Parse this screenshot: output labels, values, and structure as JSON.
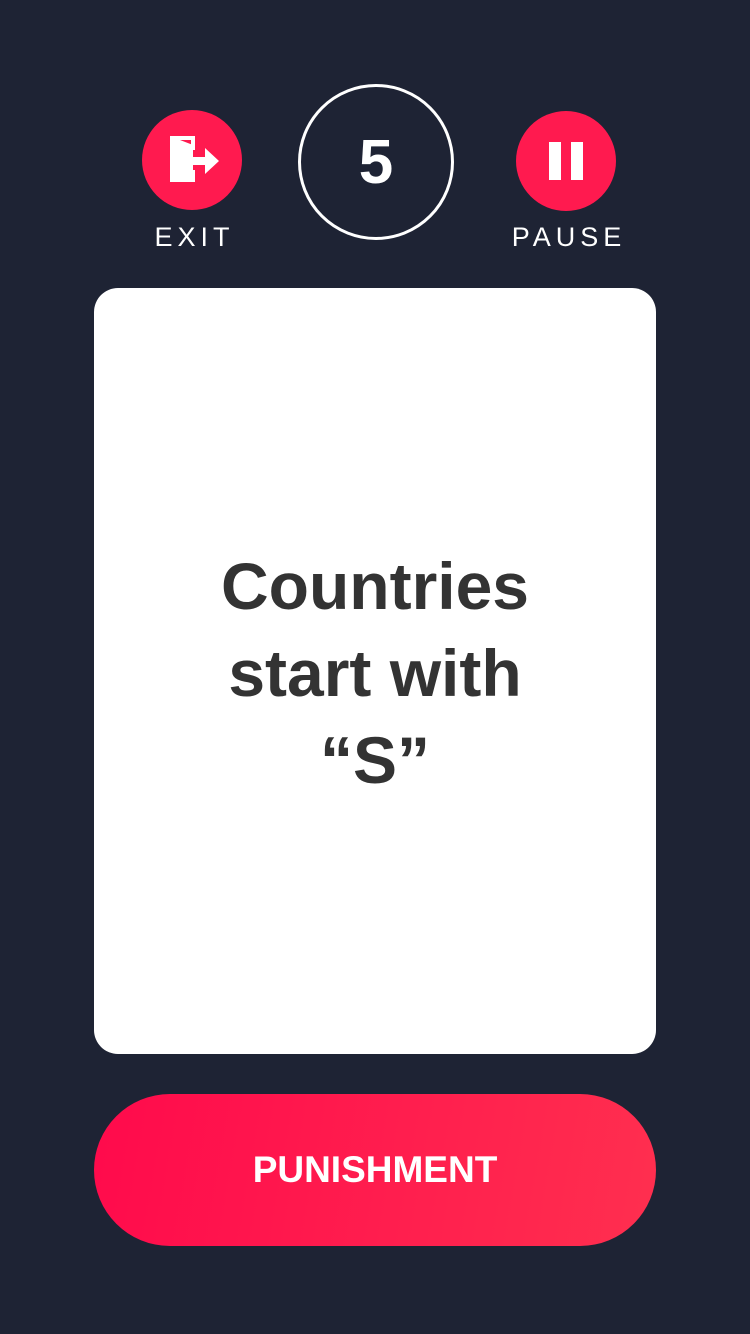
{
  "header": {
    "exit_label": "EXIT",
    "pause_label": "PAUSE",
    "timer_value": "5"
  },
  "card": {
    "prompt": "Countries start with “S”"
  },
  "actions": {
    "punishment_label": "PUNISHMENT"
  },
  "icons": {
    "exit": "exit-door-icon",
    "pause": "pause-icon"
  },
  "colors": {
    "background": "#1e2334",
    "accent": "#ff1a4f",
    "card": "#ffffff",
    "card_text": "#333333"
  }
}
